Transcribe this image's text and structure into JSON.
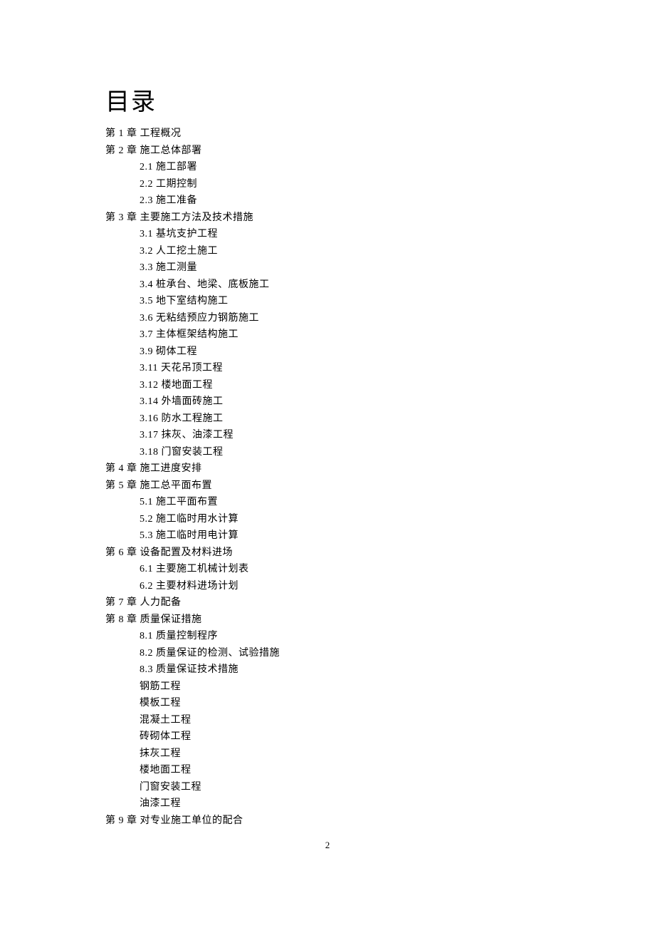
{
  "title": "目录",
  "pageNumber": "2",
  "lines": [
    {
      "cls": "chapter",
      "text": "第 1 章 工程概况"
    },
    {
      "cls": "chapter",
      "text": "第 2 章 施工总体部署"
    },
    {
      "cls": "section",
      "text": "2.1 施工部署"
    },
    {
      "cls": "section",
      "text": "2.2 工期控制"
    },
    {
      "cls": "section",
      "text": "2.3 施工准备"
    },
    {
      "cls": "chapter",
      "text": "第 3 章 主要施工方法及技术措施"
    },
    {
      "cls": "section",
      "text": "3.1 基坑支护工程"
    },
    {
      "cls": "section",
      "text": "3.2 人工挖土施工"
    },
    {
      "cls": "section",
      "text": "3.3 施工测量"
    },
    {
      "cls": "section",
      "text": "3.4 桩承台、地梁、底板施工"
    },
    {
      "cls": "section",
      "text": "3.5 地下室结构施工"
    },
    {
      "cls": "section",
      "text": "3.6 无粘结预应力钢筋施工"
    },
    {
      "cls": "section",
      "text": "3.7 主体框架结构施工"
    },
    {
      "cls": "section",
      "text": "3.9 砌体工程"
    },
    {
      "cls": "section",
      "text": "3.11 天花吊顶工程"
    },
    {
      "cls": "section",
      "text": "3.12 楼地面工程"
    },
    {
      "cls": "section",
      "text": "3.14 外墙面砖施工"
    },
    {
      "cls": "section",
      "text": "3.16 防水工程施工"
    },
    {
      "cls": "section",
      "text": "3.17 抹灰、油漆工程"
    },
    {
      "cls": "section",
      "text": "3.18 门窗安装工程"
    },
    {
      "cls": "chapter",
      "text": "第 4 章 施工进度安排"
    },
    {
      "cls": "chapter",
      "text": "第 5 章 施工总平面布置"
    },
    {
      "cls": "section",
      "text": "5.1 施工平面布置"
    },
    {
      "cls": "section",
      "text": "5.2 施工临时用水计算"
    },
    {
      "cls": "section",
      "text": "5.3 施工临时用电计算"
    },
    {
      "cls": "chapter",
      "text": "第 6 章 设备配置及材料进场"
    },
    {
      "cls": "section",
      "text": "6.1 主要施工机械计划表"
    },
    {
      "cls": "section",
      "text": "6.2 主要材料进场计划"
    },
    {
      "cls": "chapter",
      "text": "第 7 章 人力配备"
    },
    {
      "cls": "chapter",
      "text": "第 8 章 质量保证措施"
    },
    {
      "cls": "section",
      "text": "8.1 质量控制程序"
    },
    {
      "cls": "section",
      "text": "8.2 质量保证的检测、试验措施"
    },
    {
      "cls": "section",
      "text": "8.3 质量保证技术措施"
    },
    {
      "cls": "section",
      "text": "钢筋工程"
    },
    {
      "cls": "section",
      "text": "模板工程"
    },
    {
      "cls": "section",
      "text": "混凝土工程"
    },
    {
      "cls": "section",
      "text": "砖砌体工程"
    },
    {
      "cls": "section",
      "text": "抹灰工程"
    },
    {
      "cls": "section",
      "text": "楼地面工程"
    },
    {
      "cls": "section",
      "text": "门窗安装工程"
    },
    {
      "cls": "section",
      "text": "油漆工程"
    },
    {
      "cls": "chapter",
      "text": "第 9 章 对专业施工单位的配合"
    }
  ]
}
